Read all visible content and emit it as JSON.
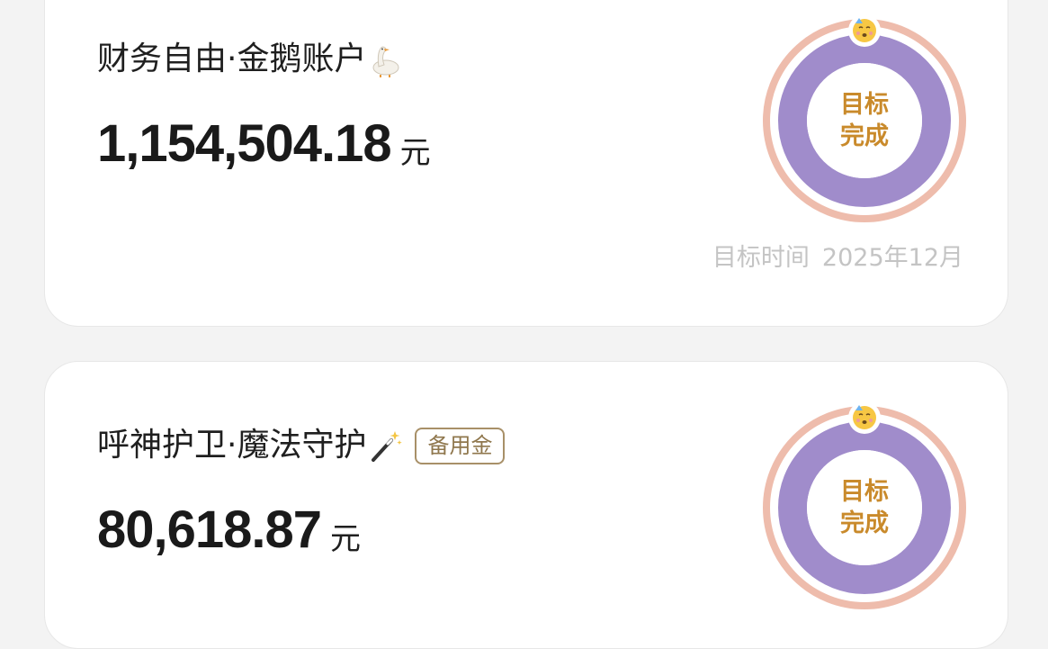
{
  "accounts": [
    {
      "title": "财务自由·金鹅账户",
      "title_icon": "goose-icon",
      "amount": "1,154,504.18",
      "unit": "元",
      "progress_label_line1": "目标",
      "progress_label_line2": "完成",
      "progress_fraction": 1.0,
      "progress_icon": "celebrating-face-icon",
      "target_time_label": "目标时间",
      "target_time_value": "2025年12月"
    },
    {
      "title": "呼神护卫·魔法守护",
      "title_icon": "magic-wand-icon",
      "badge": "备用金",
      "amount": "80,618.87",
      "unit": "元",
      "progress_label_line1": "目标",
      "progress_label_line2": "完成",
      "progress_fraction": 1.0,
      "progress_icon": "celebrating-face-icon"
    }
  ],
  "colors": {
    "ring_fill": "#a08ccb",
    "ring_outer": "#eebcac",
    "ring_label": "#c98a2b",
    "badge_border": "#a89068",
    "muted_text": "#c4c4c4"
  }
}
